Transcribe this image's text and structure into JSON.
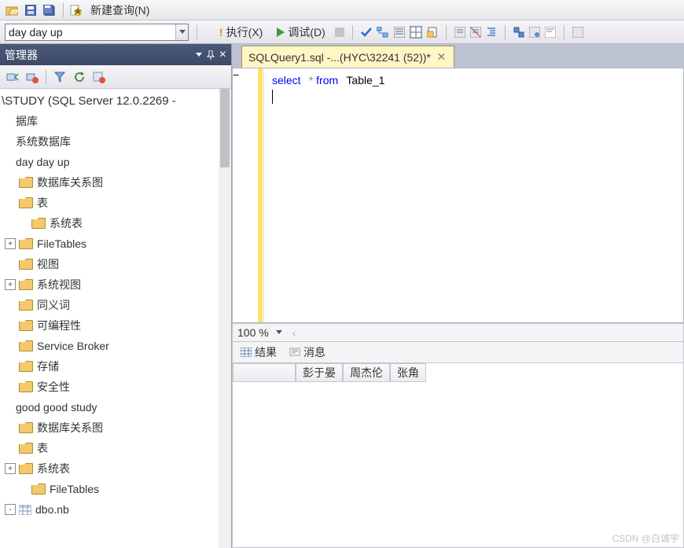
{
  "toolbar1": {
    "new_query": "新建查询(N)"
  },
  "toolbar2": {
    "combo": "day day up",
    "execute": "执行(X)",
    "debug": "调试(D)"
  },
  "sidebar": {
    "title": "管理器",
    "root": "\\STUDY (SQL Server 12.0.2269 -",
    "items": [
      {
        "lvl": 1,
        "exp": "",
        "icon": "",
        "label": "据库"
      },
      {
        "lvl": 1,
        "exp": "",
        "icon": "",
        "label": "系统数据库"
      },
      {
        "lvl": 1,
        "exp": "",
        "icon": "",
        "label": "day day up"
      },
      {
        "lvl": 2,
        "exp": "",
        "icon": "folder",
        "label": "数据库关系图"
      },
      {
        "lvl": 2,
        "exp": "",
        "icon": "folder",
        "label": "表"
      },
      {
        "lvl": 3,
        "exp": "",
        "icon": "folder",
        "label": "系统表"
      },
      {
        "lvl": 2,
        "exp": "+",
        "icon": "folder",
        "label": "FileTables"
      },
      {
        "lvl": 2,
        "exp": "",
        "icon": "folder",
        "label": "视图"
      },
      {
        "lvl": 2,
        "exp": "+",
        "icon": "folder",
        "label": "系统视图"
      },
      {
        "lvl": 2,
        "exp": "",
        "icon": "folder",
        "label": "同义词"
      },
      {
        "lvl": 2,
        "exp": "",
        "icon": "folder",
        "label": "可编程性"
      },
      {
        "lvl": 2,
        "exp": "",
        "icon": "folder",
        "label": "Service Broker"
      },
      {
        "lvl": 2,
        "exp": "",
        "icon": "folder",
        "label": "存储"
      },
      {
        "lvl": 2,
        "exp": "",
        "icon": "folder",
        "label": "安全性"
      },
      {
        "lvl": 1,
        "exp": "",
        "icon": "",
        "label": "good good study"
      },
      {
        "lvl": 2,
        "exp": "",
        "icon": "folder",
        "label": "数据库关系图"
      },
      {
        "lvl": 2,
        "exp": "",
        "icon": "folder",
        "label": "表"
      },
      {
        "lvl": 2,
        "exp": "+",
        "icon": "folder",
        "label": "系统表"
      },
      {
        "lvl": 3,
        "exp": "",
        "icon": "folder",
        "label": "FileTables"
      },
      {
        "lvl": 2,
        "exp": "-",
        "icon": "table",
        "label": "dbo.nb"
      }
    ]
  },
  "tab": {
    "label": "SQLQuery1.sql -...(HYC\\32241 (52))*"
  },
  "code": {
    "kw1": "select",
    "star": "*",
    "kw2": "from",
    "tbl": "Table_1"
  },
  "zoom": {
    "value": "100 %"
  },
  "results": {
    "tab1": "结果",
    "tab2": "消息",
    "headers": [
      "彭于晏",
      "周杰伦",
      "张角"
    ]
  },
  "watermark": "CSDN @白诚宇"
}
